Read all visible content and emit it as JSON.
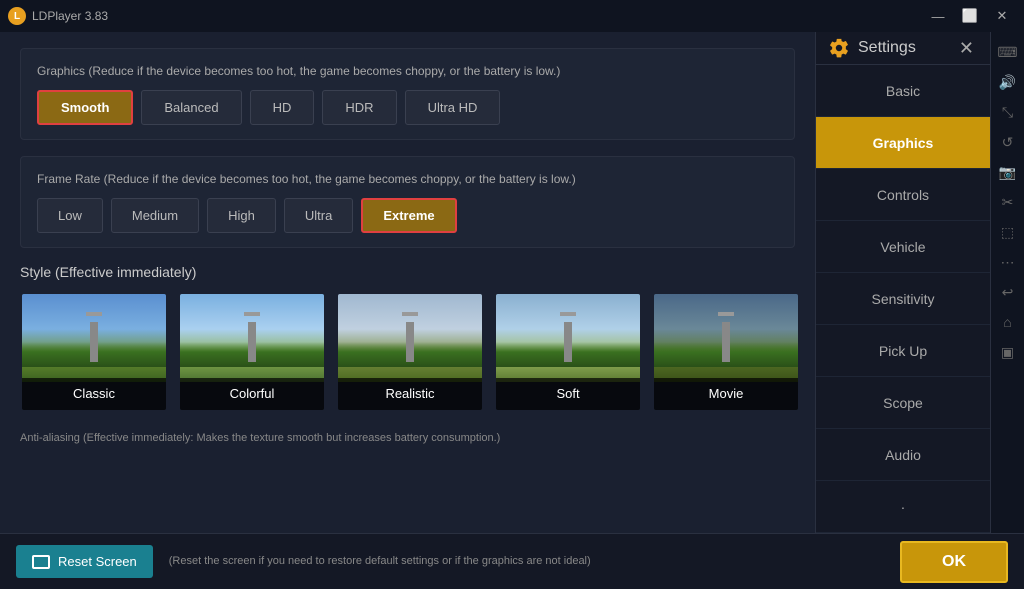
{
  "titlebar": {
    "logo": "L",
    "title": "LDPlayer 3.83",
    "controls": [
      "—",
      "⬜",
      "✕"
    ]
  },
  "graphics_section": {
    "label": "Graphics (Reduce if the device becomes too hot, the game becomes choppy, or the battery is low.)",
    "quality_options": [
      {
        "id": "smooth",
        "label": "Smooth",
        "active": true
      },
      {
        "id": "balanced",
        "label": "Balanced",
        "active": false
      },
      {
        "id": "hd",
        "label": "HD",
        "active": false
      },
      {
        "id": "hdr",
        "label": "HDR",
        "active": false
      },
      {
        "id": "ultra_hd",
        "label": "Ultra HD",
        "active": false
      }
    ]
  },
  "framerate_section": {
    "label": "Frame Rate (Reduce if the device becomes too hot, the game becomes choppy, or the battery is low.)",
    "rate_options": [
      {
        "id": "low",
        "label": "Low",
        "active": false
      },
      {
        "id": "medium",
        "label": "Medium",
        "active": false
      },
      {
        "id": "high",
        "label": "High",
        "active": false
      },
      {
        "id": "ultra",
        "label": "Ultra",
        "active": false
      },
      {
        "id": "extreme",
        "label": "Extreme",
        "active": true
      }
    ]
  },
  "style_section": {
    "label": "Style (Effective immediately)",
    "cards": [
      {
        "id": "classic",
        "label": "Classic",
        "img_class": "classic"
      },
      {
        "id": "colorful",
        "label": "Colorful",
        "img_class": "colorful"
      },
      {
        "id": "realistic",
        "label": "Realistic",
        "img_class": "realistic"
      },
      {
        "id": "soft",
        "label": "Soft",
        "img_class": "soft"
      },
      {
        "id": "movie",
        "label": "Movie",
        "img_class": "movie"
      }
    ]
  },
  "anti_alias_hint": "Anti-aliasing (Effective immediately: Makes the texture smooth but increases battery consumption.)",
  "bottom_bar": {
    "reset_label": "Reset Screen",
    "reset_hint": "(Reset the screen if you need to restore default settings or if the graphics are not ideal)",
    "ok_label": "OK"
  },
  "settings_panel": {
    "title": "Settings",
    "nav_items": [
      {
        "id": "basic",
        "label": "Basic",
        "active": false
      },
      {
        "id": "graphics",
        "label": "Graphics",
        "active": true
      },
      {
        "id": "controls",
        "label": "Controls",
        "active": false
      },
      {
        "id": "vehicle",
        "label": "Vehicle",
        "active": false
      },
      {
        "id": "sensitivity",
        "label": "Sensitivity",
        "active": false
      },
      {
        "id": "pick_up",
        "label": "Pick Up",
        "active": false
      },
      {
        "id": "scope",
        "label": "Scope",
        "active": false
      },
      {
        "id": "audio",
        "label": "Audio",
        "active": false
      }
    ]
  },
  "icon_strip": {
    "icons": [
      "⌨",
      "🔊",
      "↩",
      "⬚",
      "⬚",
      "✂",
      "⬚",
      "⋯",
      "↺",
      "⬜",
      "⬚"
    ]
  }
}
